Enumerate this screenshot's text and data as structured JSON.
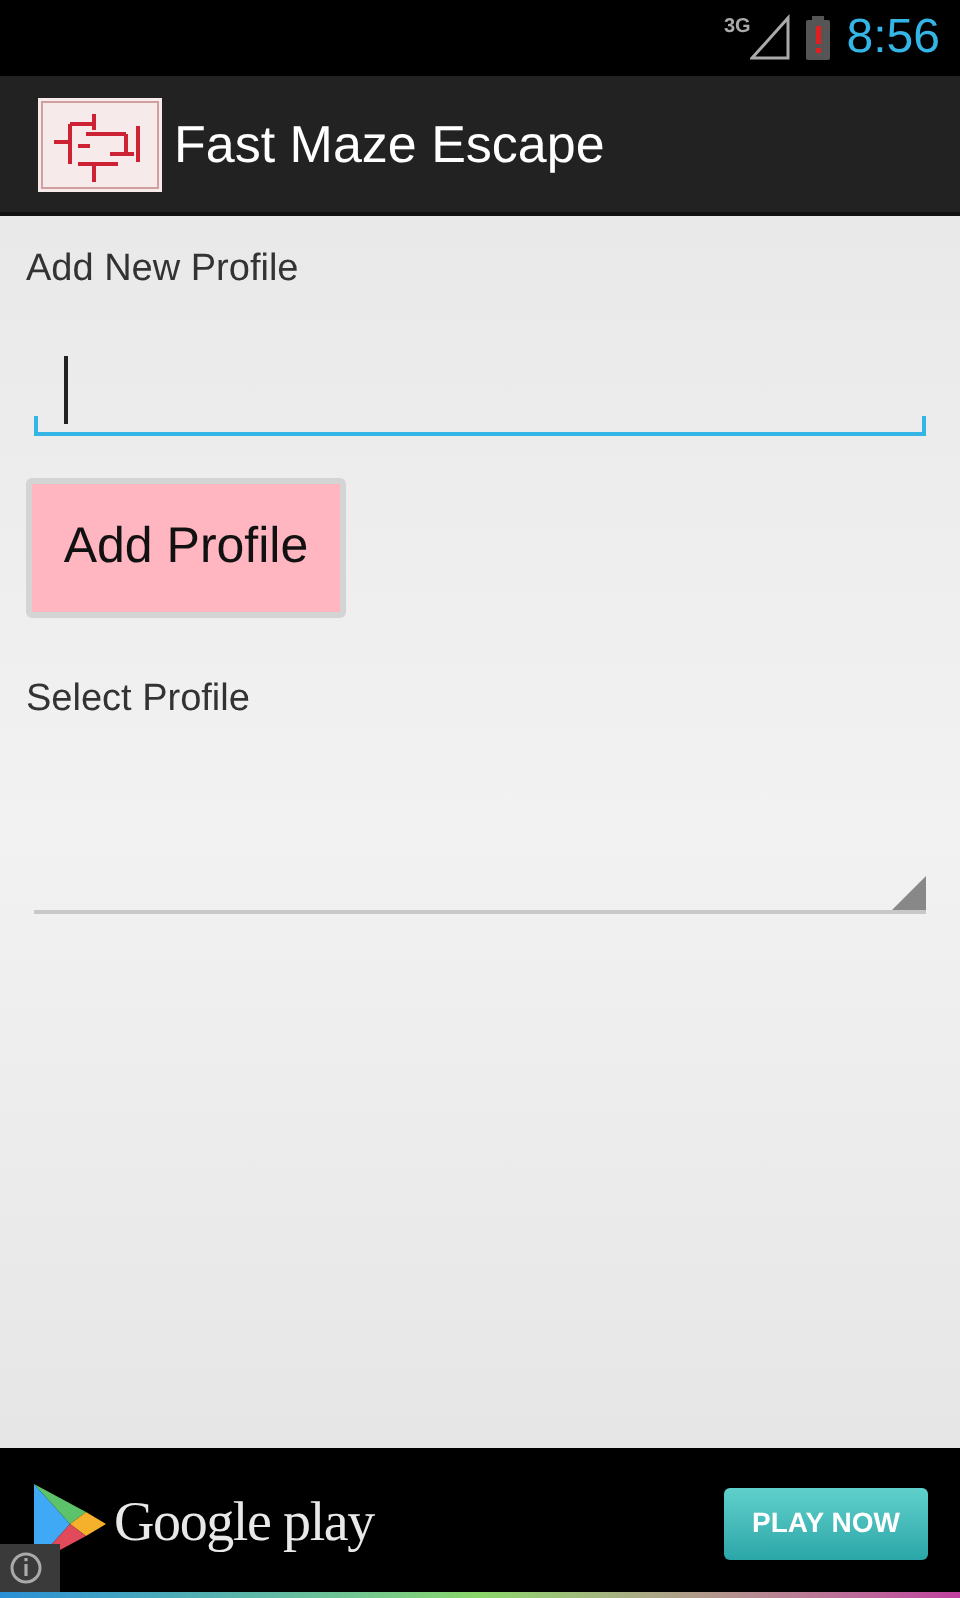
{
  "status_bar": {
    "network": "3G",
    "time": "8:56"
  },
  "action_bar": {
    "title": "Fast Maze Escape"
  },
  "add_profile": {
    "label": "Add New Profile",
    "button": "Add Profile"
  },
  "select_profile": {
    "label": "Select Profile"
  },
  "ad_banner": {
    "brand": "Google play",
    "button": "PLAY NOW"
  }
}
